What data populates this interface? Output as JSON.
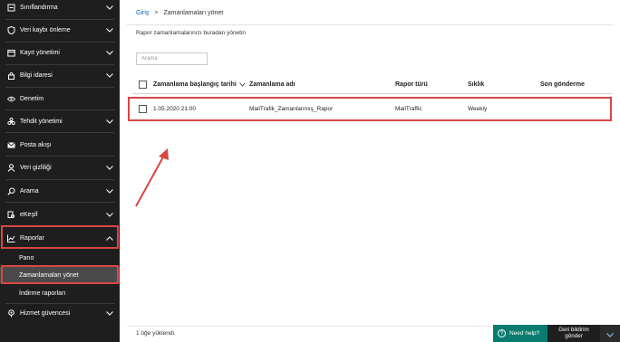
{
  "sidebar": {
    "items": [
      {
        "label": "Sınıflandırma",
        "icon": "classification-icon"
      },
      {
        "label": "Veri kaybı önleme",
        "icon": "shield-icon"
      },
      {
        "label": "Kayıt yönetimi",
        "icon": "records-icon"
      },
      {
        "label": "Bilgi idaresi",
        "icon": "lock-icon"
      },
      {
        "label": "Denetim",
        "icon": "eye-icon"
      },
      {
        "label": "Tehdit yönetimi",
        "icon": "biohazard-icon"
      },
      {
        "label": "Posta akışı",
        "icon": "mail-icon"
      },
      {
        "label": "Veri gizliliği",
        "icon": "person-icon"
      },
      {
        "label": "Arama",
        "icon": "search-icon"
      },
      {
        "label": "eKeşif",
        "icon": "discovery-icon"
      },
      {
        "label": "Raporlar",
        "icon": "chart-icon"
      },
      {
        "label": "Hizmet güvencesi",
        "icon": "service-icon"
      }
    ],
    "sub_items": [
      {
        "label": "Pano"
      },
      {
        "label": "Zamanlamaları yönet"
      },
      {
        "label": "İndirme raporları"
      }
    ]
  },
  "breadcrumb": {
    "home": "Giriş",
    "separator": ">",
    "current": "Zamanlamaları yönet"
  },
  "page": {
    "subtitle": "Rapor zamanlamalarınızı buradan yönetin",
    "search_placeholder": "Arama"
  },
  "table": {
    "columns": [
      "Zamanlama başlangıç tarihi",
      "Zamanlama adı",
      "Rapor türü",
      "Sıklık",
      "Son gönderme"
    ],
    "rows": [
      {
        "start": "1.05.2020 21:00",
        "name": "MailTrafik_Zamanlanmış_Rapor",
        "type": "MailTraffic",
        "frequency": "Weekly",
        "last_sent": ""
      }
    ]
  },
  "status": {
    "text": "1 öğe yüklendi."
  },
  "footer": {
    "help_label": "Need help?",
    "feedback_line1": "Geri bildirim",
    "feedback_line2": "gönder"
  },
  "colors": {
    "sidebar_bg": "#1e1e1e",
    "highlight": "#d94545",
    "accent": "#0a7c6f",
    "link": "#0a66b8"
  }
}
